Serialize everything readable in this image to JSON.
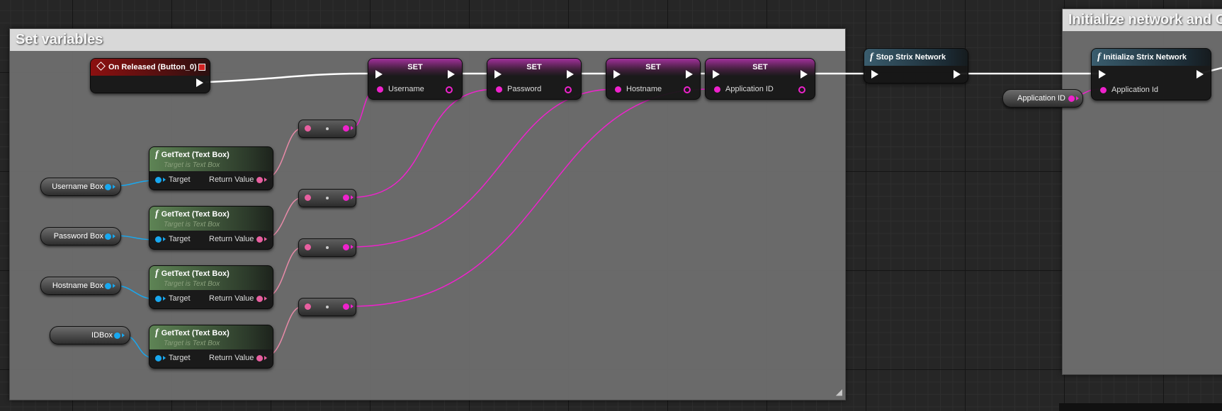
{
  "comments": {
    "set_variables": "Set variables",
    "initialize_network": "Initialize network and C"
  },
  "event_node": {
    "title": "On Released (Button_0)",
    "icon": "event-diamond-icon"
  },
  "set_nodes": [
    {
      "title": "SET",
      "label": "Username"
    },
    {
      "title": "SET",
      "label": "Password"
    },
    {
      "title": "SET",
      "label": "Hostname"
    },
    {
      "title": "SET",
      "label": "Application ID"
    }
  ],
  "stop_node": {
    "title": "Stop Strix Network"
  },
  "init_node": {
    "title": "Initialize Strix Network",
    "pin": "Application Id"
  },
  "app_id_var": "Application ID",
  "gettext_nodes": [
    {
      "title": "GetText (Text Box)",
      "subtitle": "Target is Text Box",
      "target": "Target",
      "return": "Return Value"
    },
    {
      "title": "GetText (Text Box)",
      "subtitle": "Target is Text Box",
      "target": "Target",
      "return": "Return Value"
    },
    {
      "title": "GetText (Text Box)",
      "subtitle": "Target is Text Box",
      "target": "Target",
      "return": "Return Value"
    },
    {
      "title": "GetText (Text Box)",
      "subtitle": "Target is Text Box",
      "target": "Target",
      "return": "Return Value"
    }
  ],
  "var_nodes": [
    "Username Box",
    "Password Box",
    "Hostname Box",
    "IDBox"
  ],
  "function_icon": "f",
  "colors": {
    "exec": "#ffffff",
    "string_pin": "#ee22cc",
    "text_pin": "#e85fa0",
    "object_pin": "#18a8f0",
    "event_header": "#8c1010",
    "function_header": "#3a5d6e",
    "pure_header": "#5e8455",
    "set_header": "#a0309a"
  }
}
